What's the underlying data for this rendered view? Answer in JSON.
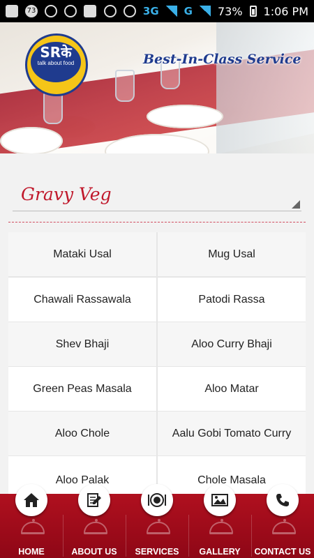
{
  "status_bar": {
    "notification_count": "73",
    "network_3g": "3G",
    "network_g": "G",
    "battery_percent": "73%",
    "time": "1:06 PM"
  },
  "banner": {
    "logo_text": "SRके",
    "logo_subtext": "talk about food",
    "tagline": "Best-In-Class Service"
  },
  "category_dropdown": {
    "selected": "Gravy Veg"
  },
  "menu_items": [
    "Mataki Usal",
    "Mug Usal",
    "Chawali Rassawala",
    "Patodi Rassa",
    "Shev Bhaji",
    "Aloo Curry Bhaji",
    "Green Peas Masala",
    "Aloo Matar",
    "Aloo Chole",
    "Aalu Gobi Tomato Curry",
    "Aloo Palak",
    "Chole Masala"
  ],
  "footer_nav": [
    {
      "label": "HOME",
      "icon": "home-icon"
    },
    {
      "label": "ABOUT US",
      "icon": "edit-icon"
    },
    {
      "label": "SERVICES",
      "icon": "plate-icon"
    },
    {
      "label": "GALLERY",
      "icon": "gallery-icon"
    },
    {
      "label": "CONTACT US",
      "icon": "phone-icon"
    }
  ],
  "colors": {
    "brand_red": "#c0182b",
    "footer_red": "#a00c1a",
    "logo_blue": "#1f3b8e",
    "logo_yellow": "#f5c518"
  }
}
